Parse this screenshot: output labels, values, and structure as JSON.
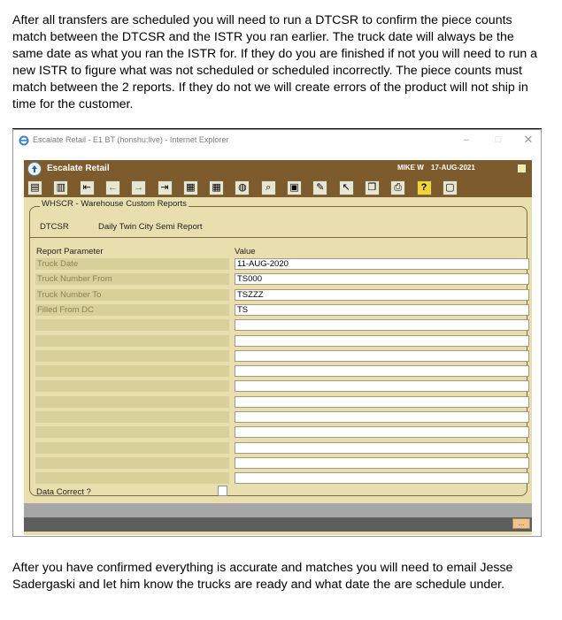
{
  "instructions": {
    "para1": "After all transfers are scheduled you will need to run a DTCSR to confirm the piece counts match between the DTCSR and the ISTR you ran earlier.  The truck date will always be the same date as what you ran the ISTR for.  If they do you are finished if not you will need to run a new ISTR to figure what was not scheduled or scheduled incorrectly.  The piece counts must match between the 2 reports.  If they do not we will create errors of the product will not ship in time for the customer.",
    "para2": "After you have confirmed everything is accurate and matches you will need to email Jesse Sadergaski and let him know the trucks are ready and what date the are schedule under."
  },
  "browser": {
    "title": "Escalate Retail - E1 BT (honshu:live) - Internet Explorer",
    "minimize": "–",
    "maximize": "□",
    "close": "✕"
  },
  "app": {
    "title": "Escalate Retail",
    "user": "MIKE W",
    "date": "17-AUG-2021"
  },
  "toolbar": [
    {
      "icon": "clear-form-icon",
      "glyph": "▤"
    },
    {
      "icon": "clear-record-icon",
      "glyph": "▥"
    },
    {
      "icon": "first-record-icon",
      "glyph": "⇤"
    },
    {
      "icon": "previous-record-icon",
      "glyph": "←"
    },
    {
      "icon": "next-record-icon",
      "glyph": "→"
    },
    {
      "icon": "last-record-icon",
      "glyph": "⇥"
    },
    {
      "icon": "calendar-icon",
      "glyph": "▦"
    },
    {
      "icon": "calendar-2-icon",
      "glyph": "▦"
    },
    {
      "icon": "binoculars-icon",
      "glyph": "◍"
    },
    {
      "icon": "search-icon",
      "glyph": "⌕"
    },
    {
      "icon": "save-icon",
      "glyph": "▣"
    },
    {
      "icon": "edit-icon",
      "glyph": "✎"
    },
    {
      "icon": "pointer-icon",
      "glyph": "↖"
    },
    {
      "icon": "copy-icon",
      "glyph": "❐"
    },
    {
      "icon": "print-icon",
      "glyph": "⎙"
    },
    {
      "icon": "help-icon",
      "glyph": "?"
    },
    {
      "icon": "exit-icon",
      "glyph": "▢"
    }
  ],
  "form": {
    "section": "WHSCR - Warehouse Custom Reports",
    "code": "DTCSR",
    "name": "Daily Twin City Semi Report",
    "param_header": "Report Parameter",
    "value_header": "Value",
    "rows": [
      {
        "param": "Truck Date",
        "value": "11-AUG-2020"
      },
      {
        "param": "Truck Number From",
        "value": "TS000"
      },
      {
        "param": "Truck Number To",
        "value": "TSZZZ"
      },
      {
        "param": "Filled From DC",
        "value": "TS"
      },
      {
        "param": "",
        "value": ""
      },
      {
        "param": "",
        "value": ""
      },
      {
        "param": "",
        "value": ""
      },
      {
        "param": "",
        "value": ""
      },
      {
        "param": "",
        "value": ""
      },
      {
        "param": "",
        "value": ""
      },
      {
        "param": "",
        "value": ""
      },
      {
        "param": "",
        "value": ""
      },
      {
        "param": "",
        "value": ""
      },
      {
        "param": "",
        "value": ""
      },
      {
        "param": "",
        "value": ""
      }
    ],
    "data_correct_label": "Data Correct ?",
    "ellipsis": "..."
  },
  "colors": {
    "app_background": "#e9dfae",
    "header_brown": "#7e5b2d",
    "param_cell": "#d8d09a",
    "param_text": "#8c8153"
  }
}
